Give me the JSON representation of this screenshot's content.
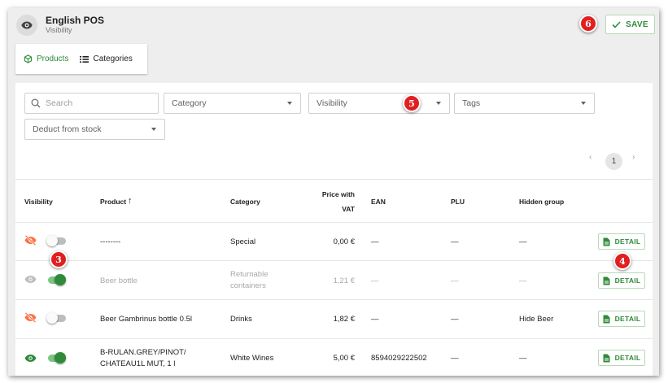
{
  "header": {
    "title": "English POS",
    "subtitle": "Visibility",
    "save_label": "SAVE"
  },
  "tabs": [
    {
      "label": "Products",
      "active": true
    },
    {
      "label": "Categories",
      "active": false
    }
  ],
  "filters": {
    "search_placeholder": "Search",
    "category": "Category",
    "visibility": "Visibility",
    "tags": "Tags",
    "deduct": "Deduct from stock"
  },
  "pagination": {
    "current": "1",
    "prev": "‹",
    "next": "›"
  },
  "columns": {
    "visibility": "Visibility",
    "product": "Product",
    "sort_indicator": "↑",
    "category": "Category",
    "price_line1": "Price with",
    "price_line2": "VAT",
    "ean": "EAN",
    "plu": "PLU",
    "hidden_group": "Hidden group"
  },
  "rows": [
    {
      "visible": false,
      "toggle_on": false,
      "product": "--------",
      "category": "Special",
      "price": "0,00 €",
      "ean": "—",
      "plu": "—",
      "hidden_group": "—",
      "detail": "DETAIL"
    },
    {
      "visible": true,
      "toggle_on": true,
      "muted": true,
      "product": "Beer bottle",
      "category_line1": "Returnable",
      "category_line2": "containers",
      "price": "1,21 €",
      "ean": "—",
      "plu": "—",
      "hidden_group": "—",
      "detail": "DETAIL"
    },
    {
      "visible": false,
      "toggle_on": false,
      "product": "Beer Gambrinus bottle 0.5l",
      "category": "Drinks",
      "price": "1,82 €",
      "ean": "—",
      "plu": "—",
      "hidden_group": "Hide Beer",
      "detail": "DETAIL"
    },
    {
      "visible": true,
      "toggle_on": true,
      "product_line1": "B-RULAN.GREY/PINOT/",
      "product_line2": "CHATEAU1L MUT, 1 l",
      "category": "White Wines",
      "price": "5,00 €",
      "ean": "8594029222502",
      "plu": "—",
      "hidden_group": "—",
      "detail": "DETAIL"
    }
  ],
  "badges": {
    "b3": "3",
    "b4": "4",
    "b5": "5",
    "b6": "6"
  },
  "colors": {
    "accent_green": "#2e8b3a",
    "hidden_orange": "#ff7043",
    "badge_red": "#e02020"
  },
  "icons": [
    "eye-icon",
    "check-icon",
    "cube-icon",
    "list-icon",
    "search-icon",
    "eye-off-icon",
    "document-icon",
    "arrow-up-icon"
  ]
}
